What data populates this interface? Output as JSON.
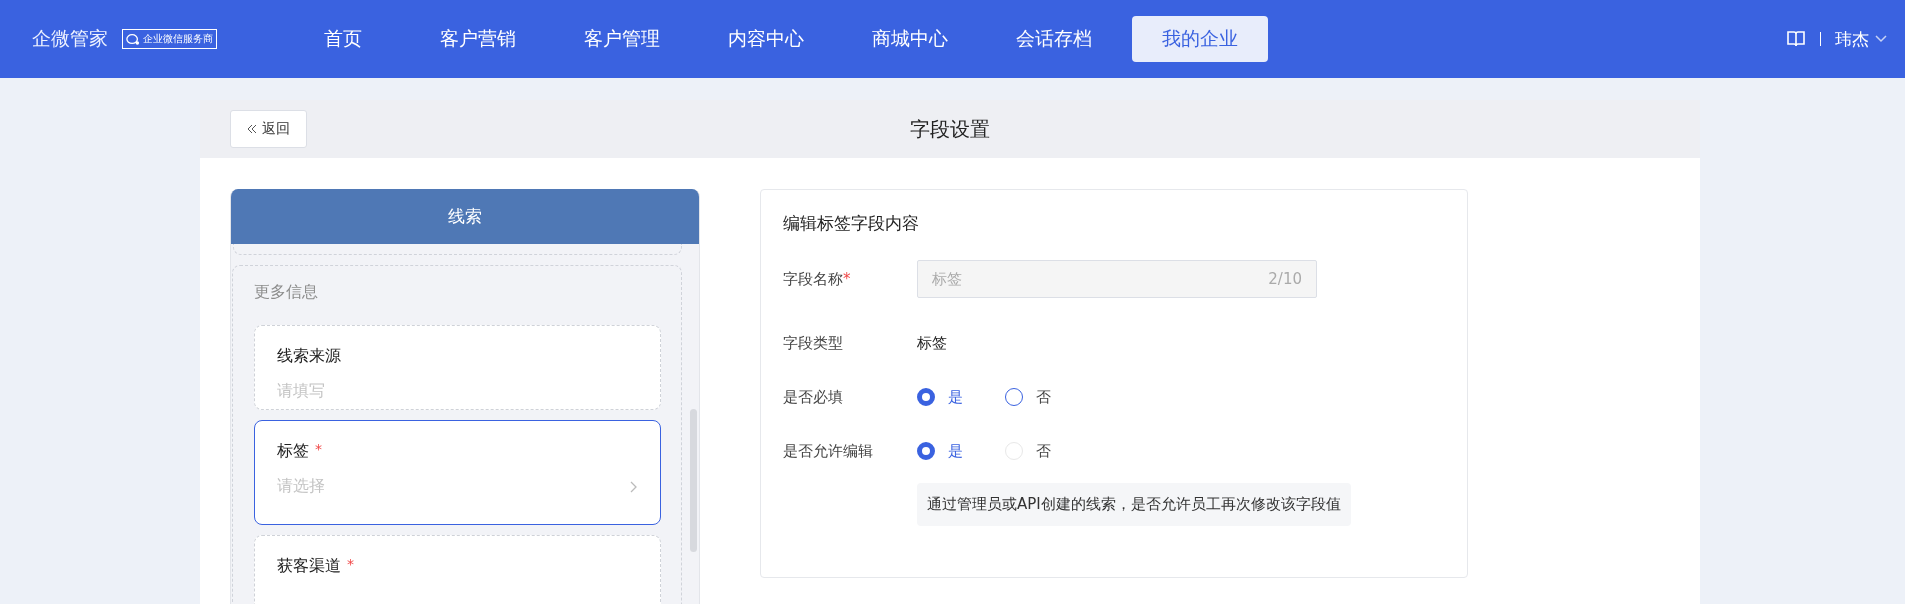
{
  "header": {
    "logo": "企微管家",
    "badge": "企业微信服务商",
    "nav": [
      {
        "label": "首页",
        "selected": false
      },
      {
        "label": "客户营销",
        "selected": false
      },
      {
        "label": "客户管理",
        "selected": false
      },
      {
        "label": "内容中心",
        "selected": false
      },
      {
        "label": "商城中心",
        "selected": false
      },
      {
        "label": "会话存档",
        "selected": false
      },
      {
        "label": "我的企业",
        "selected": true
      }
    ],
    "user": "玮杰"
  },
  "page": {
    "back": "返回",
    "title": "字段设置"
  },
  "preview": {
    "title": "线索",
    "section": "更多信息",
    "fields": [
      {
        "kind": "text",
        "label": "线索来源",
        "placeholder": "请填写",
        "selected": false
      },
      {
        "kind": "select",
        "label": "标签",
        "required_mark": "*",
        "placeholder": "请选择",
        "selected": true
      },
      {
        "label": "获客渠道",
        "required_mark": "*",
        "selected": false
      }
    ]
  },
  "editor": {
    "title": "编辑标签字段内容",
    "rows": [
      {
        "kind": "input",
        "label": "字段名称",
        "required_mark": "*",
        "value": "标签",
        "counter": "2/10"
      },
      {
        "kind": "text",
        "label": "字段类型",
        "value": "标签"
      },
      {
        "kind": "radio",
        "label": "是否必填",
        "options": [
          {
            "label": "是",
            "selected": true,
            "disabled": false
          },
          {
            "label": "否",
            "selected": false,
            "disabled": false
          }
        ]
      },
      {
        "kind": "radio",
        "label": "是否允许编辑",
        "options": [
          {
            "label": "是",
            "selected": true,
            "disabled": false
          },
          {
            "label": "否",
            "selected": false,
            "disabled": true
          }
        ],
        "note": "通过管理员或API创建的线索，是否允许员工再次修改该字段值"
      }
    ]
  }
}
